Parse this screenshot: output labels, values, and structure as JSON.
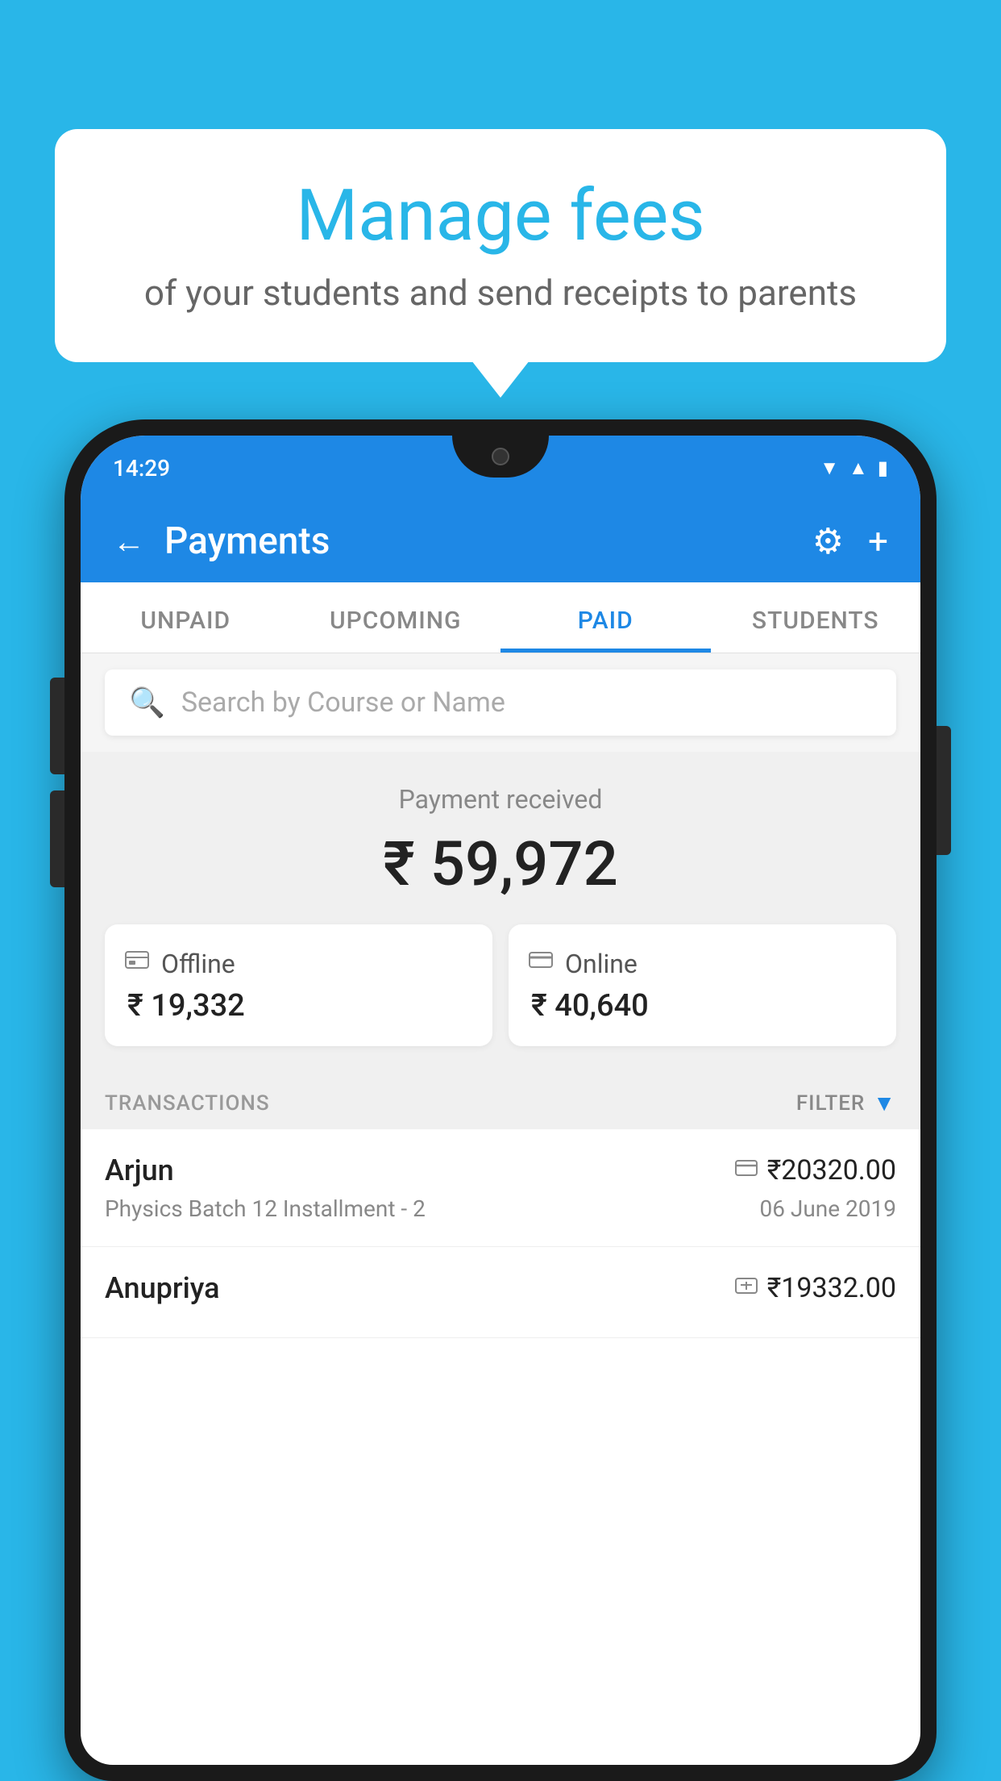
{
  "page": {
    "background_color": "#29b6e8"
  },
  "speech_bubble": {
    "title": "Manage fees",
    "subtitle": "of your students and send receipts to parents"
  },
  "phone": {
    "status_bar": {
      "time": "14:29",
      "icons": [
        "wifi",
        "signal",
        "battery"
      ]
    },
    "header": {
      "back_label": "←",
      "title": "Payments",
      "settings_icon": "⚙",
      "add_icon": "+"
    },
    "tabs": [
      {
        "label": "UNPAID",
        "active": false
      },
      {
        "label": "UPCOMING",
        "active": false
      },
      {
        "label": "PAID",
        "active": true
      },
      {
        "label": "STUDENTS",
        "active": false
      }
    ],
    "search": {
      "placeholder": "Search by Course or Name"
    },
    "payment_received": {
      "label": "Payment received",
      "amount": "₹ 59,972",
      "offline": {
        "icon": "💳",
        "label": "Offline",
        "amount": "₹ 19,332"
      },
      "online": {
        "icon": "💳",
        "label": "Online",
        "amount": "₹ 40,640"
      }
    },
    "transactions": {
      "header_label": "TRANSACTIONS",
      "filter_label": "FILTER",
      "items": [
        {
          "name": "Arjun",
          "type_icon": "💳",
          "amount": "₹20320.00",
          "course": "Physics Batch 12 Installment - 2",
          "date": "06 June 2019"
        },
        {
          "name": "Anupriya",
          "type_icon": "💵",
          "amount": "₹19332.00",
          "course": "",
          "date": ""
        }
      ]
    }
  }
}
